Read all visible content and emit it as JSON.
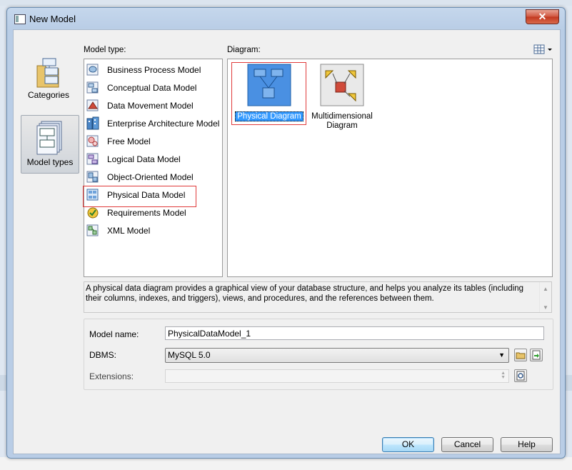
{
  "window": {
    "title": "New Model",
    "close_glyph": "✕"
  },
  "categories": [
    {
      "label": "Categories",
      "icon": "categories-icon",
      "active": false
    },
    {
      "label": "Model types",
      "icon": "model-types-icon",
      "active": true
    }
  ],
  "model_type": {
    "label": "Model type:",
    "selected": "Physical Data Model",
    "items": [
      {
        "label": "Business Process Model",
        "icon": "business-process-icon"
      },
      {
        "label": "Conceptual Data Model",
        "icon": "conceptual-data-icon"
      },
      {
        "label": "Data Movement Model",
        "icon": "data-movement-icon"
      },
      {
        "label": "Enterprise Architecture Model",
        "icon": "enterprise-architecture-icon"
      },
      {
        "label": "Free Model",
        "icon": "free-model-icon"
      },
      {
        "label": "Logical Data Model",
        "icon": "logical-data-icon"
      },
      {
        "label": "Object-Oriented Model",
        "icon": "object-oriented-icon"
      },
      {
        "label": "Physical Data Model",
        "icon": "physical-data-icon"
      },
      {
        "label": "Requirements Model",
        "icon": "requirements-icon"
      },
      {
        "label": "XML Model",
        "icon": "xml-model-icon"
      }
    ]
  },
  "diagram": {
    "label": "Diagram:",
    "items": [
      {
        "label": "Physical Diagram",
        "icon": "physical-diagram-icon",
        "selected": true
      },
      {
        "label_line1": "Multidimensional",
        "label_line2": "Diagram",
        "icon": "multidimensional-diagram-icon",
        "selected": false
      }
    ]
  },
  "description": "A physical data diagram provides a graphical view of your database structure, and helps you analyze its tables (including their columns, indexes, and triggers), views, and procedures, and the references between them.",
  "properties": {
    "model_name_label": "Model name:",
    "model_name_value": "PhysicalDataModel_1",
    "dbms_label": "DBMS:",
    "dbms_value": "MySQL 5.0",
    "extensions_label": "Extensions:",
    "extensions_value": ""
  },
  "buttons": {
    "ok": "OK",
    "cancel": "Cancel",
    "help": "Help"
  },
  "colors": {
    "selection": "#3399ff",
    "highlight_outline": "#e03a3a",
    "title_bar": "#b9cde6"
  }
}
